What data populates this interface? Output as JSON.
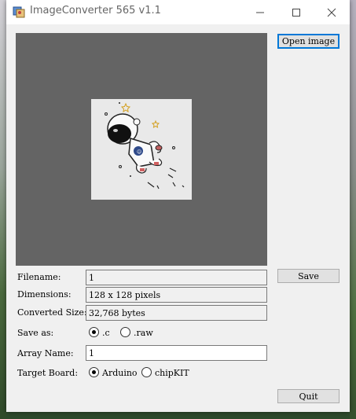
{
  "window": {
    "title": "ImageConverter 565 v1.1"
  },
  "buttons": {
    "open": "Open image",
    "save": "Save",
    "quit": "Quit"
  },
  "fields": {
    "filename": {
      "label": "Filename:",
      "value": "1"
    },
    "dimensions": {
      "label": "Dimensions:",
      "value": "128 x 128 pixels"
    },
    "converted": {
      "label": "Converted Size:",
      "value": "32,768 bytes"
    },
    "array_name": {
      "label": "Array Name:",
      "value": "1"
    }
  },
  "save_as": {
    "label": "Save as:",
    "options": [
      ".c",
      ".raw"
    ],
    "selected": ".c"
  },
  "target_board": {
    "label": "Target Board:",
    "options": [
      "Arduino",
      "chipKIT"
    ],
    "selected": "Arduino"
  },
  "preview": {
    "image": "astronaut-icon"
  },
  "colors": {
    "preview_bg": "#646464",
    "focus_border": "#0078d7",
    "window_bg": "#f0f0f0"
  }
}
